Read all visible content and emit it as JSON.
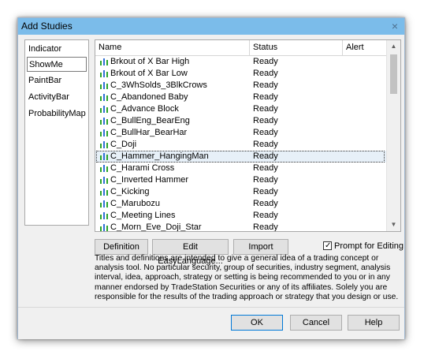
{
  "dialog": {
    "title": "Add Studies",
    "close_glyph": "×"
  },
  "nav": {
    "items": [
      {
        "label": "Indicator",
        "selected": false
      },
      {
        "label": "ShowMe",
        "selected": true
      },
      {
        "label": "PaintBar",
        "selected": false
      },
      {
        "label": "ActivityBar",
        "selected": false
      },
      {
        "label": "ProbabilityMap",
        "selected": false
      }
    ]
  },
  "table": {
    "columns": [
      "Name",
      "Status",
      "Alert"
    ],
    "rows": [
      {
        "name": "Brkout of X Bar High",
        "status": "Ready"
      },
      {
        "name": "Brkout of X Bar Low",
        "status": "Ready"
      },
      {
        "name": "C_3WhSolds_3BlkCrows",
        "status": "Ready"
      },
      {
        "name": "C_Abandoned Baby",
        "status": "Ready"
      },
      {
        "name": "C_Advance Block",
        "status": "Ready"
      },
      {
        "name": "C_BullEng_BearEng",
        "status": "Ready"
      },
      {
        "name": "C_BullHar_BearHar",
        "status": "Ready"
      },
      {
        "name": "C_Doji",
        "status": "Ready"
      },
      {
        "name": "C_Hammer_HangingMan",
        "status": "Ready",
        "selected": true
      },
      {
        "name": "C_Harami Cross",
        "status": "Ready"
      },
      {
        "name": "C_Inverted Hammer",
        "status": "Ready"
      },
      {
        "name": "C_Kicking",
        "status": "Ready"
      },
      {
        "name": "C_Marubozu",
        "status": "Ready"
      },
      {
        "name": "C_Meeting Lines",
        "status": "Ready"
      },
      {
        "name": "C_Morn_Eve_Doji_Star",
        "status": "Ready"
      }
    ],
    "icon": "study-bars-icon",
    "icon_colors": [
      "#2aa52a",
      "#2f6fd6",
      "#2aa52a"
    ]
  },
  "scrollbar": {
    "up_glyph": "▲",
    "down_glyph": "▼"
  },
  "buttons": {
    "definition": "Definition",
    "edit": "Edit EasyLanguage...",
    "import": "Import",
    "ok": "OK",
    "cancel": "Cancel",
    "help": "Help"
  },
  "prompt_for_editing": {
    "label": "Prompt for Editing",
    "checked": true,
    "check_glyph": "✓"
  },
  "disclaimer": "Titles and definitions are intended to give a general idea of a trading concept or analysis tool. No particular security, group of securities, industry segment, analysis interval, idea, approach, strategy or setting is being recommended to you or in any manner endorsed by TradeStation Securities or any of its affiliates. Solely you are responsible for the results of the trading approach or strategy that you design or use."
}
